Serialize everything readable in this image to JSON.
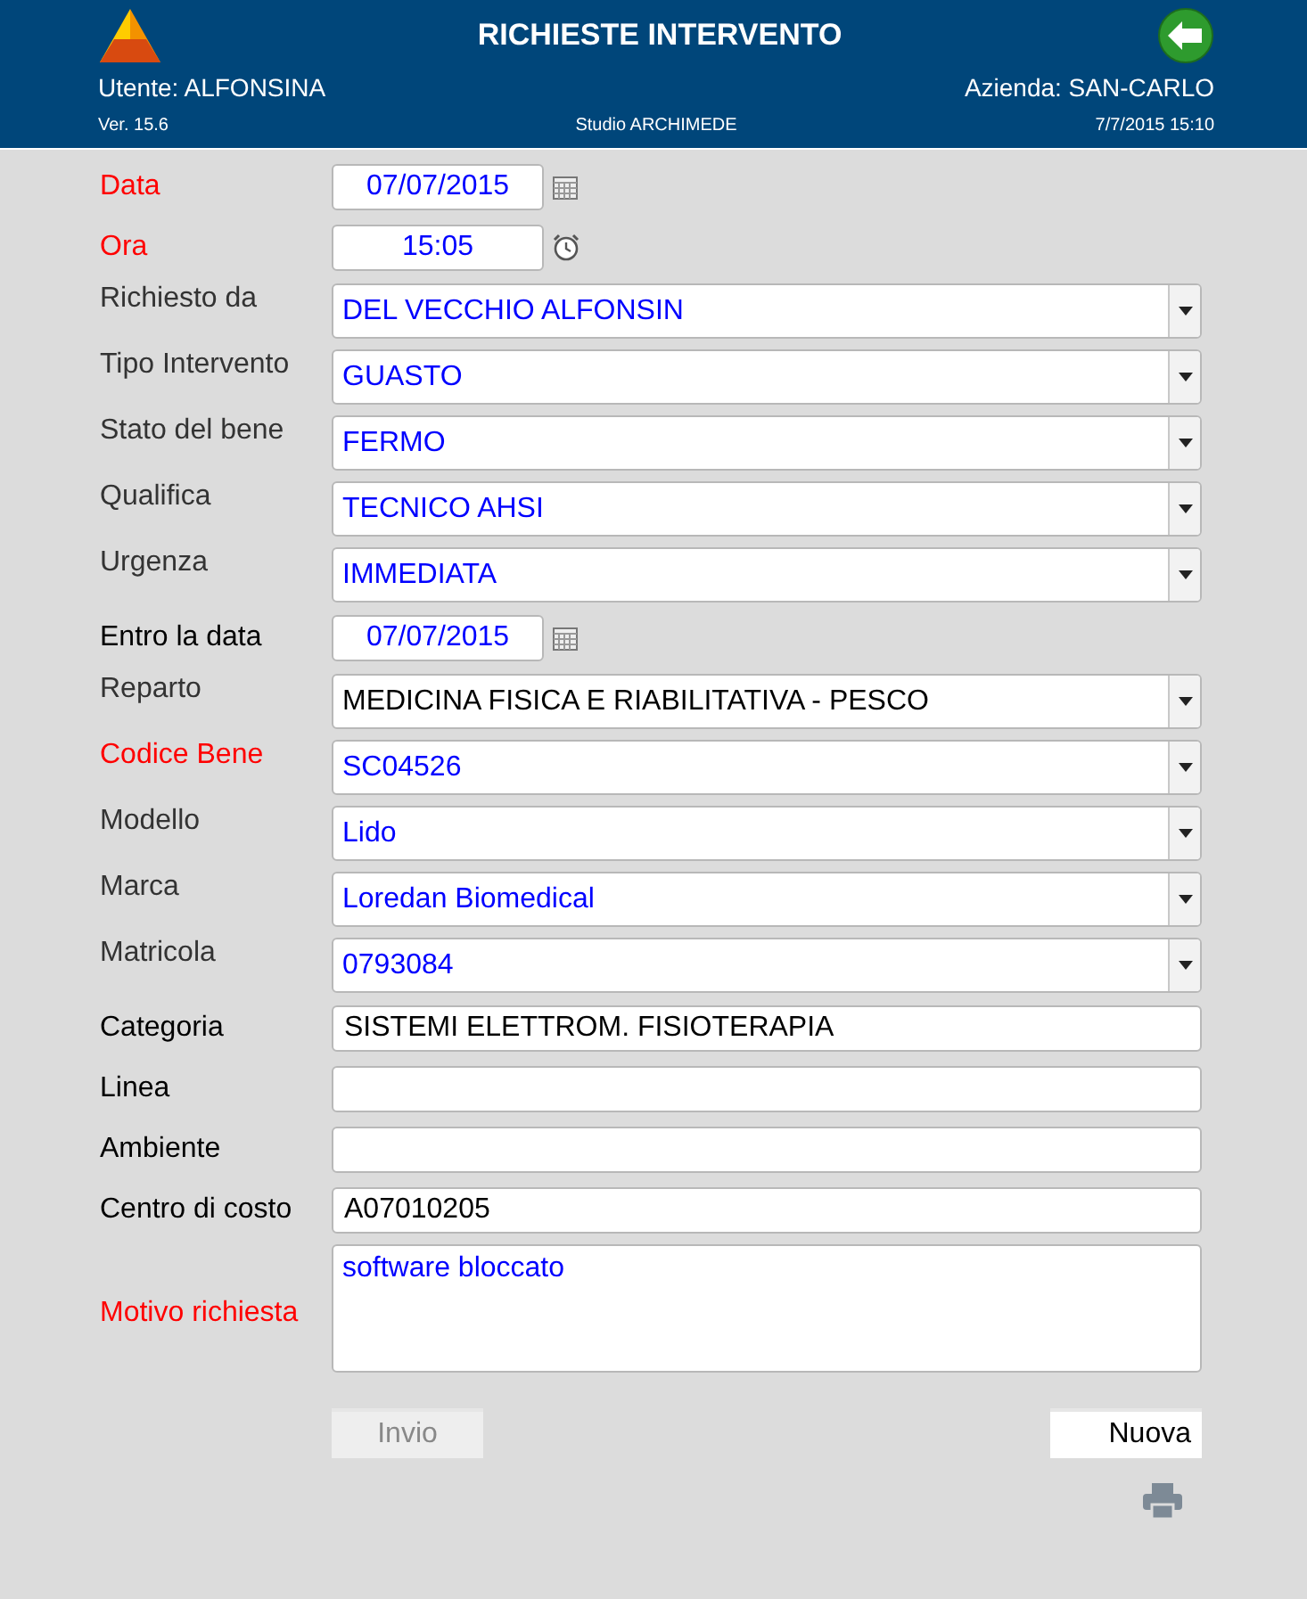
{
  "header": {
    "title": "RICHIESTE INTERVENTO",
    "user": "Utente: ALFONSINA",
    "company": "Azienda: SAN-CARLO",
    "version": "Ver. 15.6",
    "studio": "Studio ARCHIMEDE",
    "datetime": "7/7/2015 15:10"
  },
  "fields": [
    {
      "kind": "date",
      "label": "Data",
      "required": true,
      "value": "07/07/2015",
      "highlighted": true
    },
    {
      "kind": "time",
      "label": "Ora",
      "required": true,
      "value": "15:05",
      "highlighted": true
    },
    {
      "kind": "select",
      "label": "Richiesto da",
      "required": false,
      "value": "DEL VECCHIO ALFONSIN",
      "highlighted": true
    },
    {
      "kind": "select",
      "label": "Tipo Intervento",
      "required": false,
      "value": "GUASTO",
      "highlighted": true
    },
    {
      "kind": "select",
      "label": "Stato del bene",
      "required": false,
      "value": "FERMO",
      "highlighted": true
    },
    {
      "kind": "select",
      "label": "Qualifica",
      "required": false,
      "value": "TECNICO AHSI",
      "highlighted": true
    },
    {
      "kind": "select",
      "label": "Urgenza",
      "required": false,
      "value": "IMMEDIATA",
      "highlighted": true
    },
    {
      "kind": "date",
      "label": "Entro la data",
      "required": false,
      "value": "07/07/2015",
      "highlighted": true
    },
    {
      "kind": "select",
      "label": "Reparto",
      "required": false,
      "value": "MEDICINA FISICA E RIABILITATIVA - PESCO",
      "highlighted": false
    },
    {
      "kind": "select",
      "label": "Codice Bene",
      "required": true,
      "value": "SC04526",
      "highlighted": true
    },
    {
      "kind": "select",
      "label": "Modello",
      "required": false,
      "value": "Lido",
      "highlighted": true
    },
    {
      "kind": "select",
      "label": "Marca",
      "required": false,
      "value": "Loredan Biomedical",
      "highlighted": true
    },
    {
      "kind": "select",
      "label": "Matricola",
      "required": false,
      "value": "0793084",
      "highlighted": true
    },
    {
      "kind": "text",
      "label": "Categoria",
      "required": false,
      "value": "SISTEMI ELETTROM. FISIOTERAPIA",
      "highlighted": false
    },
    {
      "kind": "text",
      "label": "Linea",
      "required": false
    },
    {
      "kind": "text",
      "label": "Ambiente",
      "required": false
    },
    {
      "kind": "text",
      "label": "Centro di costo",
      "required": false,
      "value": "A07010205",
      "highlighted": false
    },
    {
      "kind": "textarea",
      "label": "Motivo richiesta",
      "required": true,
      "value": "software bloccato",
      "highlighted": true
    }
  ],
  "buttons": [
    {
      "label": "Invio",
      "disabled": true
    },
    {
      "label": "Nuova",
      "disabled": false
    }
  ]
}
